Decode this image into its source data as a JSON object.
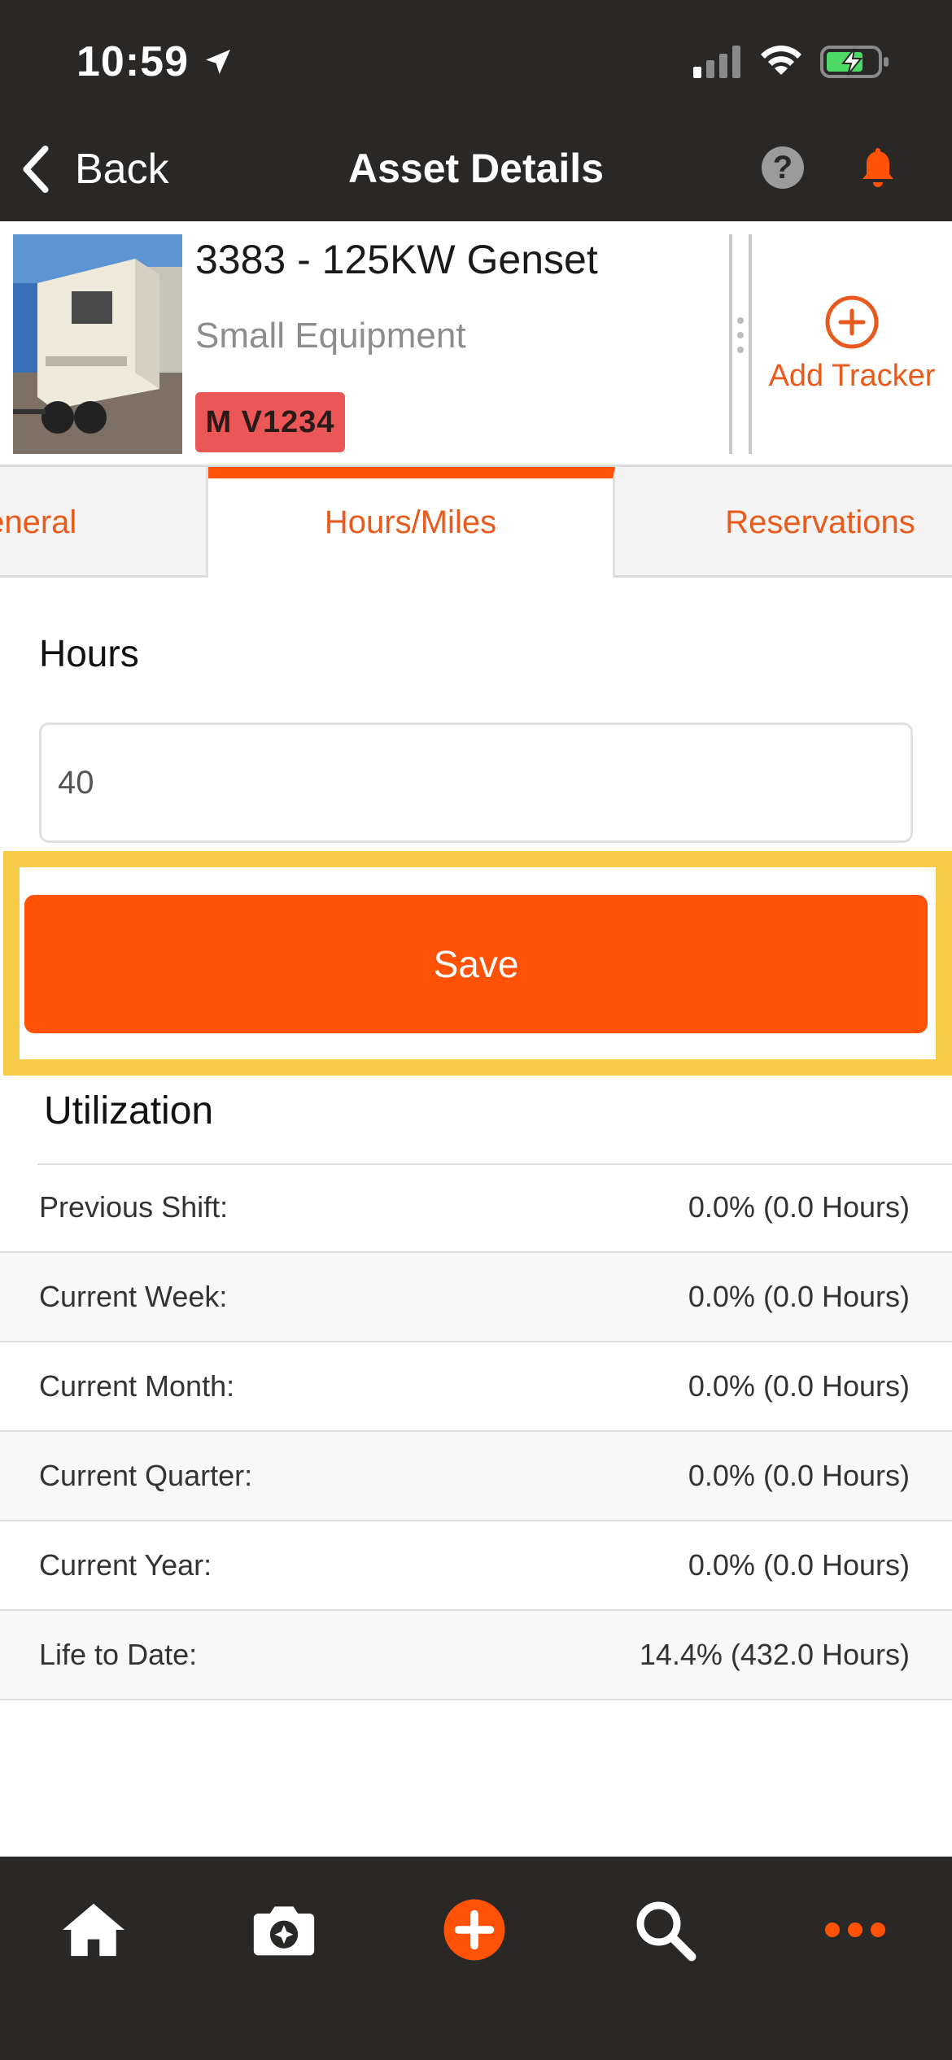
{
  "status_bar": {
    "time": "10:59"
  },
  "nav": {
    "back_label": "Back",
    "title": "Asset Details",
    "help_label": "?"
  },
  "asset": {
    "name": "3383 - 125KW Genset",
    "category": "Small Equipment",
    "badge": "M V1234",
    "add_tracker_label": "Add Tracker"
  },
  "tabs": [
    {
      "label": "General"
    },
    {
      "label": "Hours/Miles",
      "active": true
    },
    {
      "label": "Reservations"
    }
  ],
  "form": {
    "hours_label": "Hours",
    "hours_value": "40",
    "save_label": "Save"
  },
  "utilization": {
    "title": "Utilization",
    "rows": [
      {
        "label": "Previous Shift:",
        "value": "0.0% (0.0 Hours)"
      },
      {
        "label": "Current Week:",
        "value": "0.0% (0.0 Hours)"
      },
      {
        "label": "Current Month:",
        "value": "0.0% (0.0 Hours)"
      },
      {
        "label": "Current Quarter:",
        "value": "0.0% (0.0 Hours)"
      },
      {
        "label": "Current Year:",
        "value": "0.0% (0.0 Hours)"
      },
      {
        "label": "Life to Date:",
        "value": "14.4% (432.0 Hours)"
      }
    ]
  },
  "bottom_nav": [
    {
      "icon": "home-icon"
    },
    {
      "icon": "camera-icon"
    },
    {
      "icon": "add-icon"
    },
    {
      "icon": "search-icon"
    },
    {
      "icon": "more-icon"
    }
  ],
  "colors": {
    "accent": "#ff5206",
    "bar_bg": "#2a2826",
    "badge_bg": "#eb5757",
    "highlight": "#f5cb47"
  }
}
